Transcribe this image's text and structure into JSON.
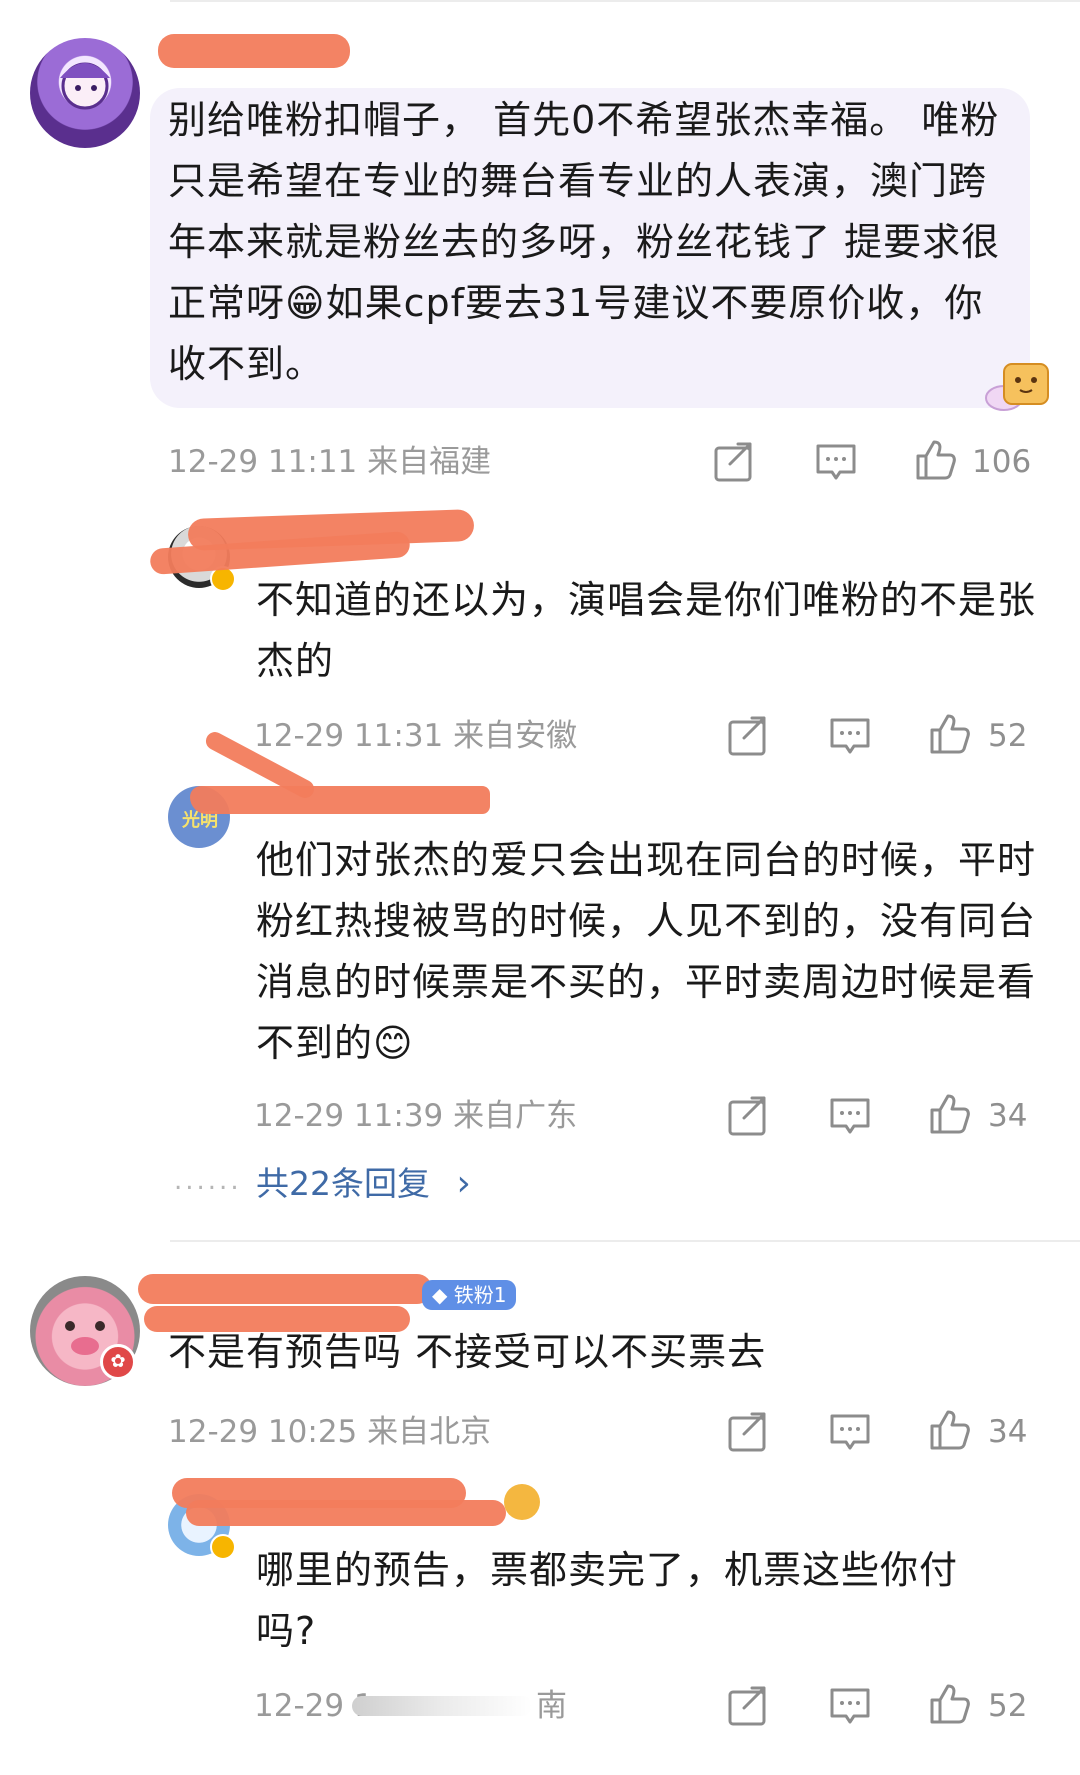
{
  "comment1": {
    "text": "别给唯粉扣帽子， 首先0不希望张杰幸福。 唯粉只是希望在专业的舞台看专业的人表演，澳门跨年本来就是粉丝去的多呀，粉丝花钱了 提要求很正常呀😁如果cpf要去31号建议不要原价收，你收不到。",
    "meta": "12-29 11:11  来自福建",
    "likes": "106"
  },
  "reply1": {
    "text": "不知道的还以为，演唱会是你们唯粉的不是张杰的",
    "meta": "12-29 11:31  来自安徽",
    "likes": "52"
  },
  "reply2": {
    "avatar_text": "光明",
    "text": "他们对张杰的爱只会出现在同台的时候，平时粉红热搜被骂的时候，人见不到的，没有同台消息的时候票是不买的，平时卖周边时候是看不到的😊",
    "meta": "12-29 11:39  来自广东",
    "likes": "34"
  },
  "more_replies": {
    "dots": "......",
    "label": "共22条回复",
    "arrow": "›"
  },
  "comment2": {
    "fan_badge": "铁粉1",
    "text": "不是有预告吗 不接受可以不买票去",
    "meta": "12-29 10:25  来自北京",
    "likes": "34"
  },
  "reply3": {
    "text": "哪里的预告，票都卖完了，机票这些你付吗?",
    "meta_start": "12-29 1",
    "meta_end": "南",
    "likes": "52"
  },
  "icons": [
    "share-icon",
    "comment-icon",
    "thumbs-up-icon",
    "verified-badge-icon",
    "cookie-sticker-icon",
    "diamond-icon"
  ],
  "colors": {
    "bubble": "#f4f1fb",
    "link": "#3f6aa6",
    "redaction": "#f27c5c",
    "meta": "#9a9a9a"
  }
}
